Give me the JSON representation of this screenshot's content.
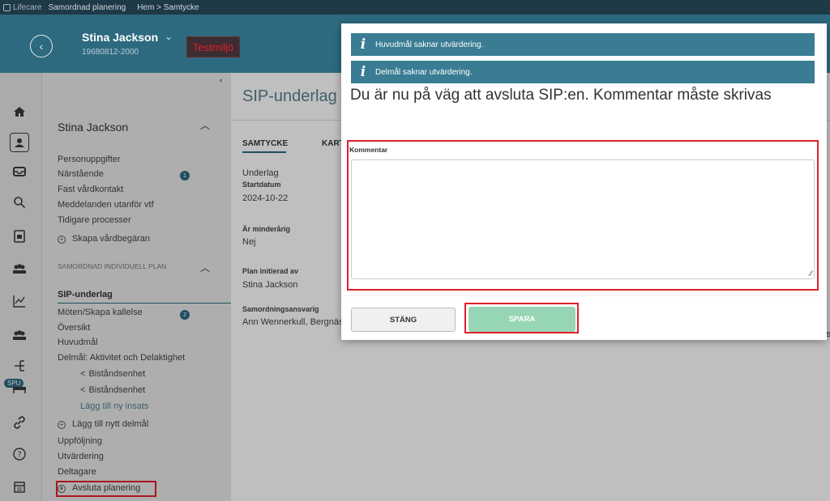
{
  "topbar": {
    "logo_text": "Lifecare",
    "app_name": "Samordnad planering",
    "breadcrumb": "Hem > Samtycke"
  },
  "header": {
    "patient_name": "Stina Jackson",
    "patient_id": "19680812-2000",
    "environment_badge": "Testmiljö"
  },
  "sidebar": {
    "heading": "Stina Jackson",
    "items": [
      {
        "label": "Personuppgifter"
      },
      {
        "label": "Närstående",
        "badge": "1"
      },
      {
        "label": "Fast vårdkontakt"
      },
      {
        "label": "Meddelanden utanför vtf"
      },
      {
        "label": "Tidigare processer"
      },
      {
        "label": "Skapa vårdbegäran"
      }
    ],
    "section_title": "SAMORDNAD INDIVIDUELL PLAN",
    "active_item": "SIP-underlag",
    "plan_items": [
      {
        "label": "Möten/Skapa kallelse",
        "badge": "2"
      },
      {
        "label": "Översikt"
      },
      {
        "label": "Huvudmål"
      },
      {
        "label": "Delmål: Aktivitet och Delaktighet"
      },
      {
        "label": "Biståndsenhet"
      },
      {
        "label": "Biståndsenhet"
      },
      {
        "label": "Lägg till ny insats"
      },
      {
        "label": "Lägg till nytt delmål"
      },
      {
        "label": "Uppföljning"
      },
      {
        "label": "Utvärdering"
      },
      {
        "label": "Deltagare"
      },
      {
        "label": "Avsluta planering"
      }
    ]
  },
  "rail": {
    "spu_badge": "SPU",
    "icons": [
      "home-icon",
      "person-icon",
      "inbox-icon",
      "search-icon",
      "document-icon",
      "group-icon",
      "chart-icon",
      "group-icon",
      "network-icon",
      "bed-icon",
      "link-icon",
      "help-icon",
      "calendar-icon"
    ]
  },
  "main": {
    "title": "SIP-underlag",
    "tabs": [
      "SAMTYCKE",
      "KART"
    ],
    "fields": {
      "underlag": "Underlag",
      "startdatum_label": "Startdatum",
      "startdatum_value": "2024-10-22",
      "minderarig_label": "Är minderårig",
      "minderarig_value": "Nej",
      "initierad_label": "Plan initierad av",
      "initierad_value": "Stina Jackson",
      "ansvarig_label": "Samordningsansvarig",
      "ansvarig_value": "Ann Wennerkull, Bergnäs"
    },
    "cut_text": "ls"
  },
  "modal": {
    "info_messages": [
      "Huvudmål saknar utvärdering.",
      "Delmål saknar utvärdering."
    ],
    "title": "Du är nu på väg att avsluta SIP:en. Kommentar måste skrivas",
    "comment_label": "Kommentar",
    "comment_value": "",
    "close_label": "STÄNG",
    "save_label": "SPARA"
  },
  "colors": {
    "header_bg": "#2d6a80",
    "info_bar": "#3a7c93",
    "save_button": "#97d6b4",
    "highlight": "#e01f2a"
  }
}
